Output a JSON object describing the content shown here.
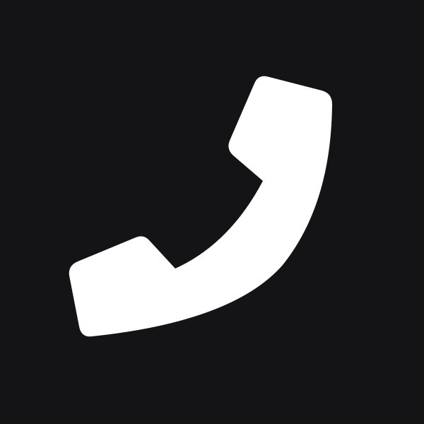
{
  "app_icon": {
    "name": "phone",
    "icon": "phone-handset-icon",
    "background_color": "#141417",
    "glyph_color": "#ffffff"
  }
}
